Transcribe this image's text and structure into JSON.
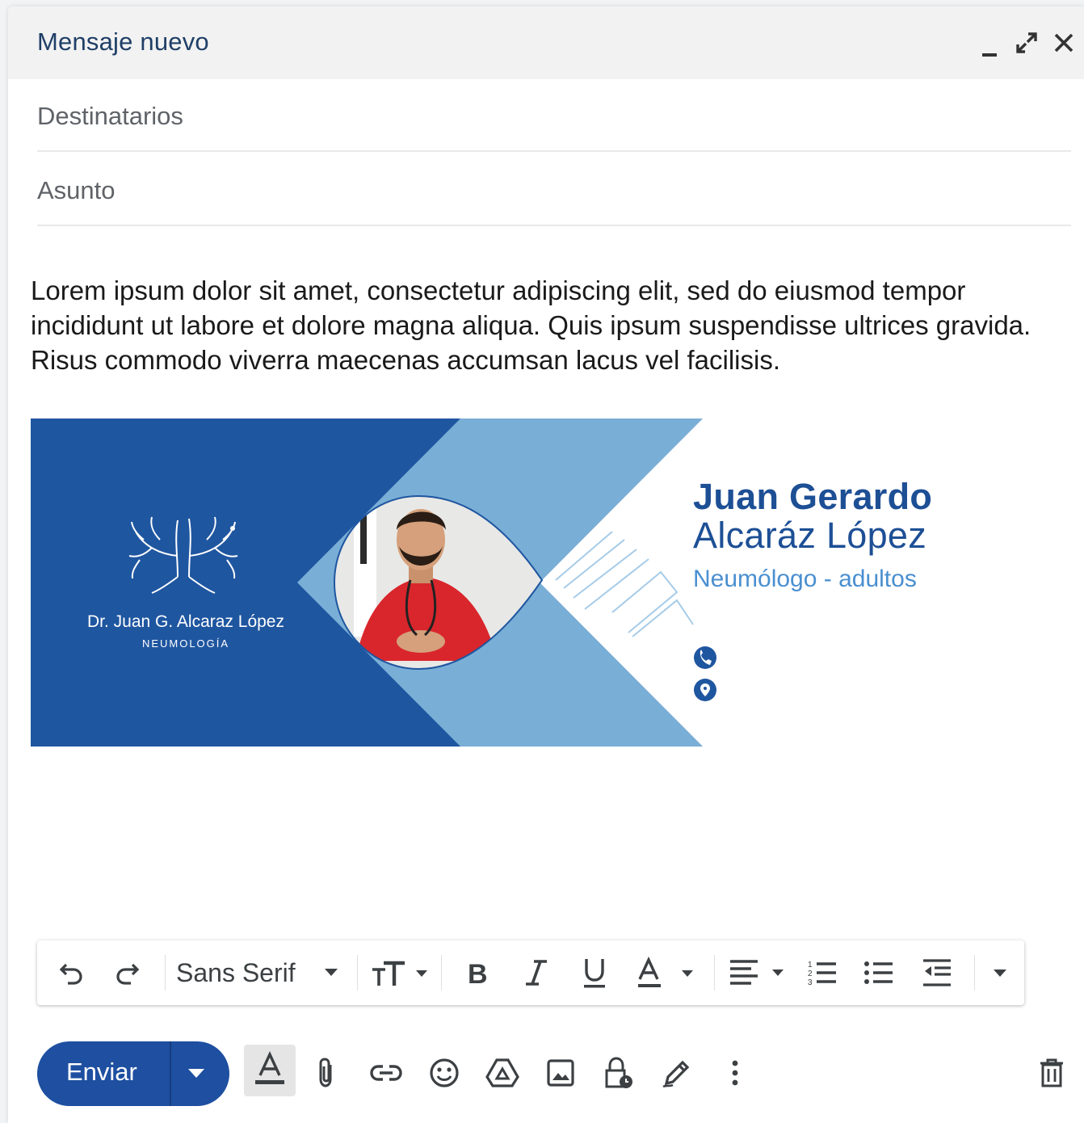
{
  "header": {
    "title": "Mensaje nuevo"
  },
  "fields": {
    "recipients_placeholder": "Destinatarios",
    "subject_placeholder": "Asunto"
  },
  "message": {
    "body": "Lorem ipsum dolor sit amet, consectetur adipiscing elit, sed do eiusmod tempor incididunt ut labore et dolore magna aliqua. Quis ipsum suspendisse ultrices gravida. Risus commodo viverra maecenas accumsan lacus vel facilisis."
  },
  "signature": {
    "logo_name": "Dr. Juan G. Alcaraz López",
    "logo_subtitle": "NEUMOLOGÍA",
    "name_line1": "Juan Gerardo",
    "name_line2": "Alcaráz López",
    "role": "Neumólogo - adultos",
    "contact_icons": [
      "phone-icon",
      "location-pin-icon"
    ],
    "colors": {
      "dark_blue": "#1f56a0",
      "light_blue": "#79aed6",
      "name_blue": "#1d4f95",
      "role_blue": "#4a8fd0"
    }
  },
  "toolbar": {
    "font": "Sans Serif",
    "icons": [
      "undo-icon",
      "redo-icon",
      "font-size-icon",
      "bold-icon",
      "italic-icon",
      "underline-icon",
      "text-color-icon",
      "align-icon",
      "numbered-list-icon",
      "bulleted-list-icon",
      "indent-less-icon",
      "more-formatting-icon"
    ]
  },
  "actions": {
    "send_label": "Enviar",
    "accent": "#1e4fa0",
    "icons": [
      "formatting-options-icon",
      "attach-icon",
      "link-icon",
      "emoji-icon",
      "drive-icon",
      "photo-icon",
      "confidential-mode-icon",
      "signature-icon",
      "more-options-icon",
      "discard-icon"
    ]
  }
}
